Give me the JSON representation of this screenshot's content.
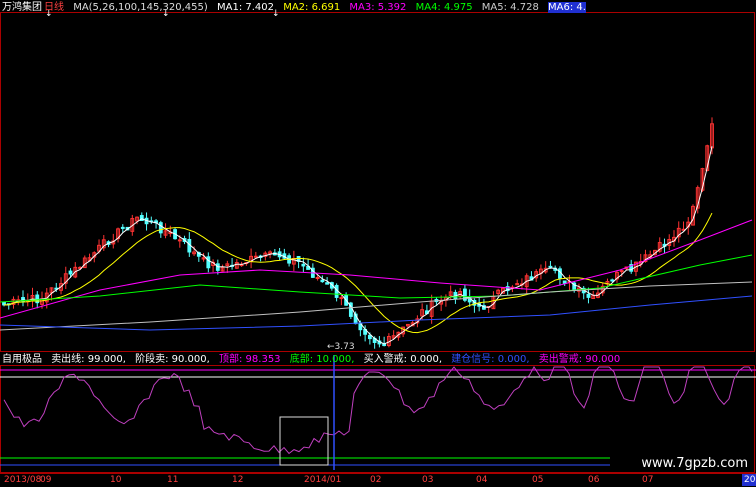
{
  "main_header": {
    "stock_name": "万鸿集团",
    "period": "日线",
    "ma_params": "MA(5,26,100,145,320,455)",
    "ma1": "MA1: 7.402",
    "ma2": "MA2: 6.691",
    "ma3": "MA3: 5.392",
    "ma4": "MA4: 4.975",
    "ma5": "MA5: 4.728",
    "ma6": "MA6: 4.",
    "arrow": "↑"
  },
  "low_marker": "←3.73",
  "indicator_header": {
    "name": "自用极品",
    "sell_line": "卖出线: 99.000,",
    "stage_sell": "阶段卖: 90.000,",
    "top": "顶部: 98.353",
    "bottom": "底部: 10.000,",
    "buy_warning": "买入警戒: 0.000,",
    "buy_signal": "建仓信号: 0.000,",
    "sell_warning": "卖出警戒: 90.000"
  },
  "date_axis": [
    "2013/08",
    "09",
    "10",
    "11",
    "12",
    "2014/01",
    "02",
    "03",
    "04",
    "05",
    "06",
    "07",
    "2014"
  ],
  "watermark": "www.7gpzb.com",
  "colors": {
    "bg": "#000000",
    "up": "#ff3333",
    "down": "#54ffff",
    "ma1": "#ffffff",
    "ma2": "#ffff00",
    "ma3": "#ff00ff",
    "ma4": "#00ff00",
    "ma5": "#c0c0c0",
    "ma6": "#3050ff",
    "indicator": "#c040c0",
    "frame": "#aa0000"
  }
}
